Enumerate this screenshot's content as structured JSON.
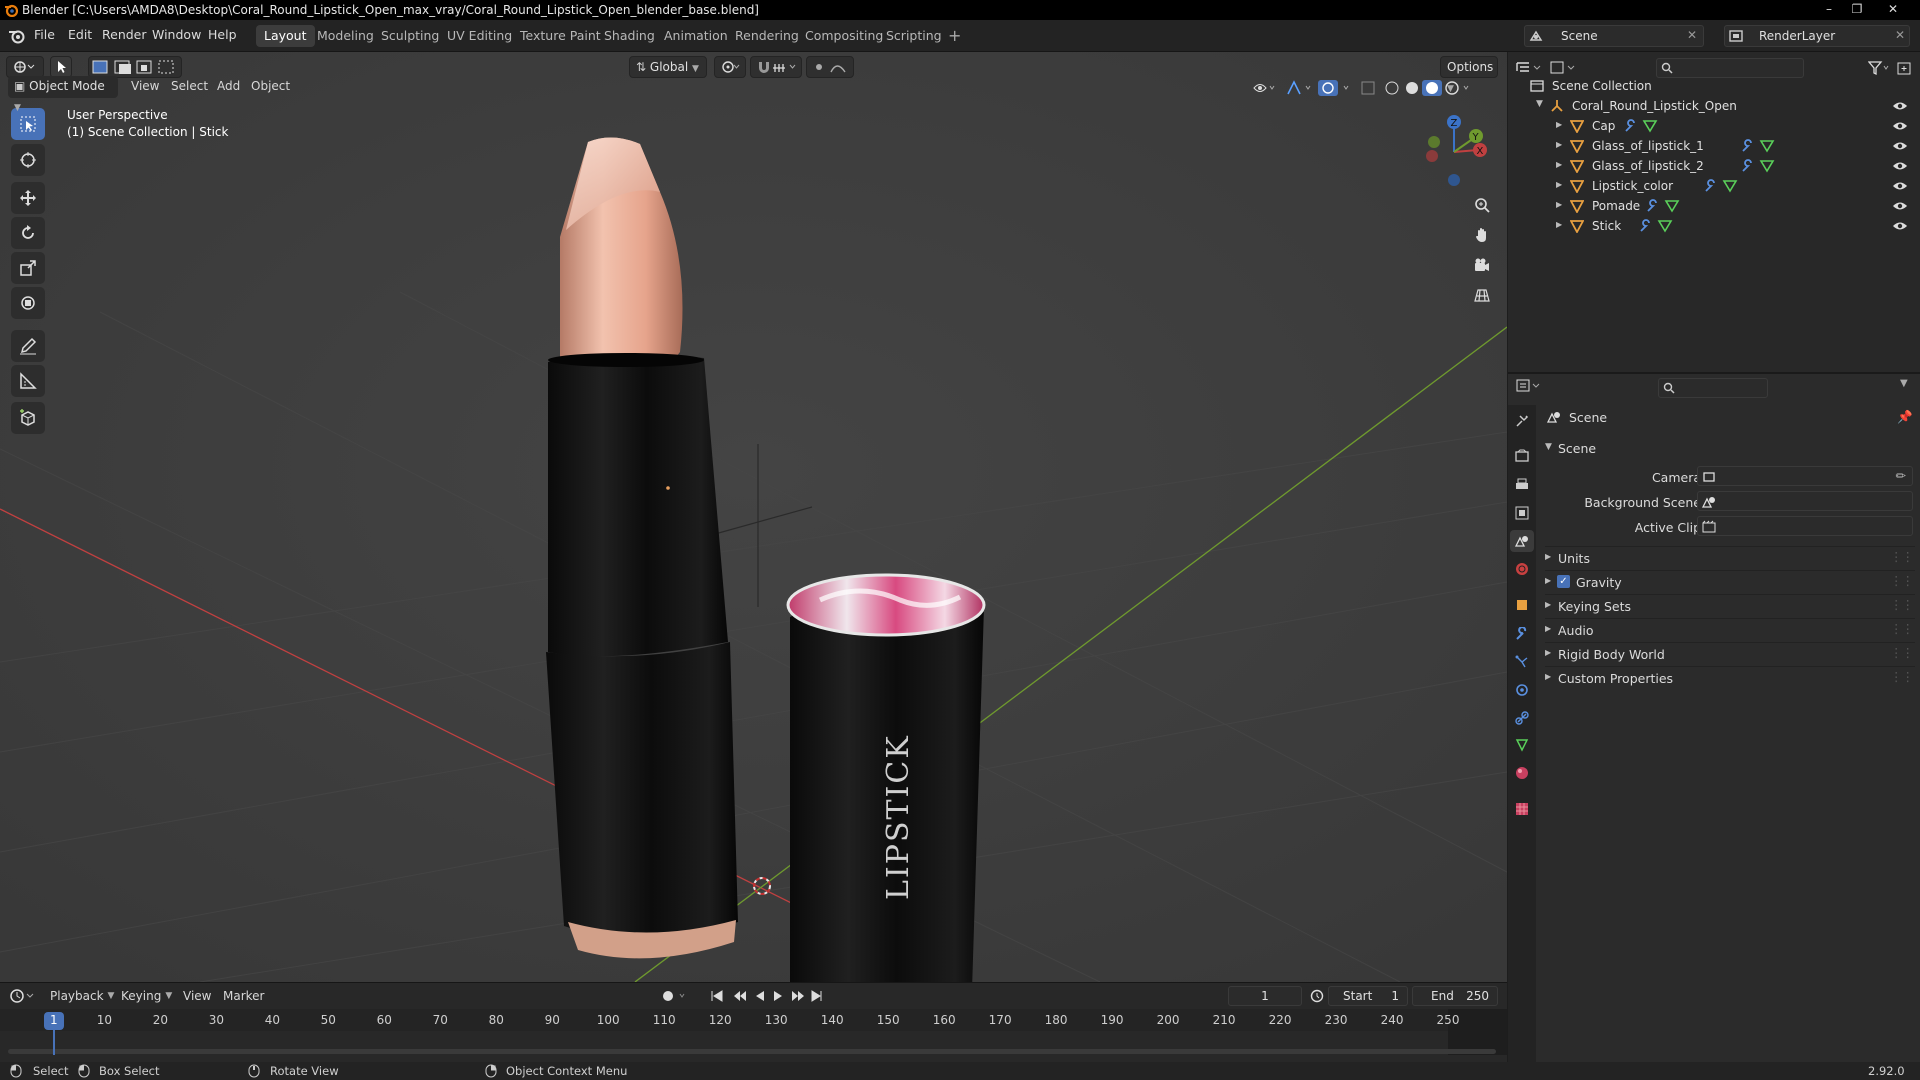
{
  "title_bar": {
    "text": "Blender [C:\\Users\\AMDA8\\Desktop\\Coral_Round_Lipstick_Open_max_vray/Coral_Round_Lipstick_Open_blender_base.blend]"
  },
  "menu": [
    "File",
    "Edit",
    "Render",
    "Window",
    "Help"
  ],
  "workspaces": [
    "Layout",
    "Modeling",
    "Sculpting",
    "UV Editing",
    "Texture Paint",
    "Shading",
    "Animation",
    "Rendering",
    "Compositing",
    "Scripting"
  ],
  "active_workspace": "Layout",
  "scene_field": "Scene",
  "render_layer_field": "RenderLayer",
  "viewport_header": {
    "transform_orientation": "Global",
    "options_label": "Options",
    "mode": "Object Mode",
    "menus": [
      "View",
      "Select",
      "Add",
      "Object"
    ]
  },
  "viewport_overlay": {
    "perspective": "User Perspective",
    "collection": "(1) Scene Collection | Stick"
  },
  "scene_objects": {
    "cap_label": "LIPSTICK"
  },
  "outliner": {
    "root": "Scene Collection",
    "collection": "Coral_Round_Lipstick_Open",
    "objects": [
      "Cap",
      "Glass_of_lipstick_1",
      "Glass_of_lipstick_2",
      "Lipstick_color",
      "Pomade",
      "Stick"
    ]
  },
  "properties": {
    "header_title": "Scene",
    "panel_title": "Scene",
    "fields": [
      {
        "label": "Camera",
        "value": ""
      },
      {
        "label": "Background Scene",
        "value": ""
      },
      {
        "label": "Active Clip",
        "value": ""
      }
    ],
    "subpanels": [
      "Units",
      "Gravity",
      "Keying Sets",
      "Audio",
      "Rigid Body World",
      "Custom Properties"
    ],
    "gravity_checked": true
  },
  "timeline": {
    "menus": [
      "Playback",
      "Keying",
      "View",
      "Marker"
    ],
    "current_frame": "1",
    "start_label": "Start",
    "start": "1",
    "end_label": "End",
    "end": "250",
    "ticks": [
      "1",
      "10",
      "20",
      "30",
      "40",
      "50",
      "60",
      "70",
      "80",
      "90",
      "100",
      "110",
      "120",
      "130",
      "140",
      "150",
      "160",
      "170",
      "180",
      "190",
      "200",
      "210",
      "220",
      "230",
      "240",
      "250"
    ]
  },
  "status_bar": {
    "select": "Select",
    "box_select": "Box Select",
    "rotate_view": "Rotate View",
    "context_menu": "Object Context Menu",
    "version": "2.92.0"
  },
  "colors": {
    "accent": "#4872b8",
    "viewport_bg": "#3d3d3d",
    "x_axis": "#c04040",
    "y_axis": "#6f9a2e",
    "mesh_icon": "#e8a040"
  }
}
